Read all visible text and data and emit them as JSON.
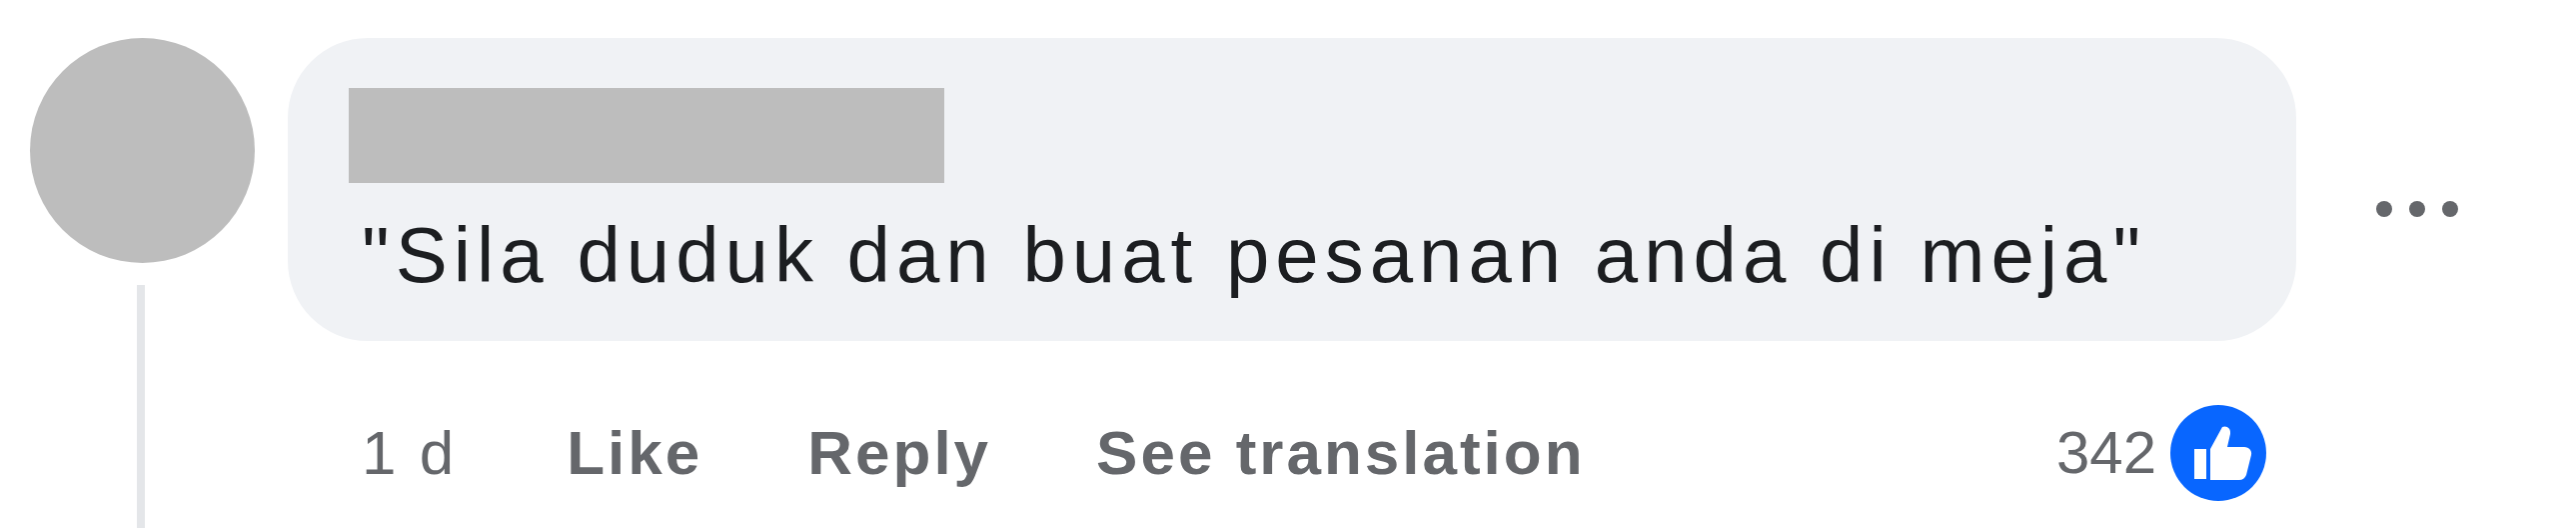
{
  "comment": {
    "text": "\"Sila duduk dan buat pesanan anda di meja\"",
    "time": "1 d",
    "actions": [
      {
        "label": "Like"
      },
      {
        "label": "Reply"
      },
      {
        "label": "See translation"
      }
    ],
    "reaction_count": "342"
  }
}
